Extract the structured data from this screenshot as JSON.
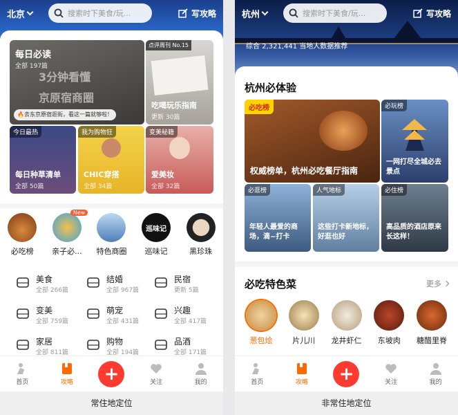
{
  "left": {
    "city": "北京",
    "search_placeholder": "搜索时下美食/玩...",
    "write_label": "写攻略",
    "feature_main": {
      "title": "每日必读",
      "sub": "全部 197篇",
      "overlay1": "3分钟看懂",
      "overlay2": "京原宿商圈",
      "note": "🔥去东京原宿逛街，看这一篇就够啦！"
    },
    "feature_side": {
      "badge": "点评周刊 No.15",
      "title": "吃喝玩乐指南",
      "sub": "更新 30篇"
    },
    "small_tiles": [
      {
        "tag": "今日最热",
        "title": "每日种草清单",
        "sub": "全部 50篇"
      },
      {
        "tag": "我为购物狂",
        "title": "CHIC穿搭",
        "sub": "全部 34篇"
      },
      {
        "tag": "变美秘籍",
        "title": "爱美妆",
        "sub": "全部 32篇"
      }
    ],
    "icons": [
      {
        "label": "必吃榜",
        "badge": ""
      },
      {
        "label": "亲子必...",
        "badge": "New"
      },
      {
        "label": "特色商圈",
        "badge": ""
      },
      {
        "label": "巡味记",
        "badge": ""
      },
      {
        "label": "黑珍珠",
        "badge": ""
      }
    ],
    "logo_text": "巡味记",
    "categories": [
      {
        "title": "美食",
        "sub": "全部 266篇",
        "icon": "food-cloche-icon"
      },
      {
        "title": "结婚",
        "sub": "全部 967篇",
        "icon": "wedding-icon"
      },
      {
        "title": "民宿",
        "sub": "更新 5篇",
        "icon": "homestay-icon"
      },
      {
        "title": "变美",
        "sub": "全部 759篇",
        "icon": "cosmetics-icon"
      },
      {
        "title": "萌宠",
        "sub": "全部 431篇",
        "icon": "pet-icon"
      },
      {
        "title": "兴趣",
        "sub": "全部 417篇",
        "icon": "book-icon"
      },
      {
        "title": "家居",
        "sub": "全部 811篇",
        "icon": "furniture-icon"
      },
      {
        "title": "购物",
        "sub": "全部 194篇",
        "icon": "shopping-bag-icon"
      },
      {
        "title": "品酒",
        "sub": "全部 171篇",
        "icon": "wine-icon"
      }
    ],
    "tabs": [
      "首页",
      "攻略",
      "",
      "关注",
      "我的"
    ],
    "caption": "常住地定位"
  },
  "right": {
    "city": "杭州",
    "search_placeholder": "搜索时下美食/玩...",
    "write_label": "写攻略",
    "stats": "综合 2,321,441 当地人数据推荐",
    "section1": "杭州必体验",
    "big_tile": {
      "badge": "必吃榜",
      "title": "权威榜单，杭州必吃餐厅指南"
    },
    "side_tile": {
      "tag": "必玩榜",
      "title": "一网打尽全城必去景点"
    },
    "small_tiles": [
      {
        "tag": "必逛榜",
        "title": "年轻人最爱的商场，滴~打卡"
      },
      {
        "tag": "人气地标",
        "title": "这些打卡新地标，好逛也好"
      },
      {
        "tag": "必住榜",
        "title": "高品质的酒店原来长这样！"
      }
    ],
    "section2": "必吃特色菜",
    "more": "更多",
    "dishes": [
      "葱包烩",
      "片儿川",
      "龙井虾仁",
      "东坡肉",
      "糖醋里脊"
    ],
    "tabs": [
      "首页",
      "攻略",
      "",
      "关注",
      "我的"
    ],
    "caption": "非常住地定位"
  },
  "colors": {
    "accent": "#ff6a00",
    "plus": "#ff3b30"
  }
}
